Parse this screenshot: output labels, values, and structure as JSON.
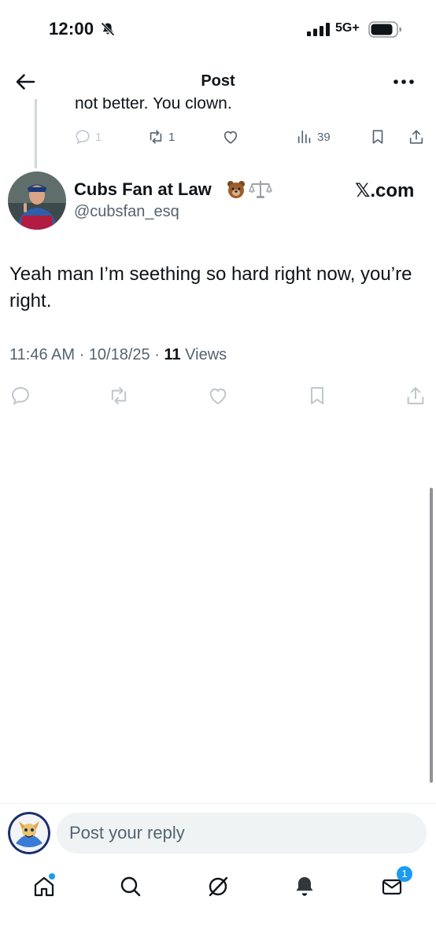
{
  "status_bar": {
    "time": "12:00",
    "network": "5G+",
    "icons": [
      "bell-slash-icon",
      "signal-icon",
      "battery-icon"
    ]
  },
  "header": {
    "title": "Post",
    "icons": [
      "back-arrow-icon",
      "more-icon"
    ]
  },
  "parent_post": {
    "text_fragment": "not better. You clown.",
    "actions": {
      "replies": "1",
      "reposts": "1",
      "views": "39"
    }
  },
  "post": {
    "author_name": "Cubs Fan at Law 🐻⚖️",
    "author_name_text": "Cubs Fan at Law",
    "author_handle": "@cubsfan_esq",
    "source": "𝕏.com",
    "text": "Yeah man I’m seething so hard right now, you’re right.",
    "time": "11:46 AM",
    "date": "10/18/25",
    "views_count": "11",
    "views_label": "Views"
  },
  "reply": {
    "placeholder": "Post your reply"
  },
  "tabs": {
    "items": [
      "home",
      "search",
      "grok",
      "notifications",
      "messages"
    ],
    "messages_badge": "1"
  },
  "colors": {
    "accent": "#1d9bf0",
    "secondary_text": "#536471",
    "primary_text": "#0f1419",
    "input_bg": "#eff3f4"
  }
}
